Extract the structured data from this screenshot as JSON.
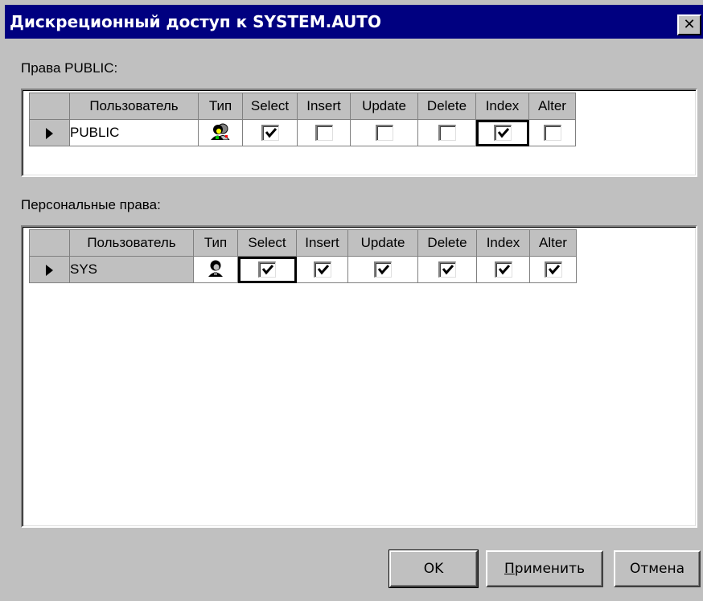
{
  "dialog": {
    "title": "Дискреционный доступ к SYSTEM.AUTO",
    "close_symbol": "✕"
  },
  "public_section": {
    "label": "Права PUBLIC:",
    "columns": [
      "Пользователь",
      "Тип",
      "Select",
      "Insert",
      "Update",
      "Delete",
      "Index",
      "Alter"
    ],
    "rows": [
      {
        "user": "PUBLIC",
        "type_icon": "user-group-icon",
        "select": true,
        "insert": false,
        "update": false,
        "delete": false,
        "index": true,
        "alter": false
      }
    ]
  },
  "personal_section": {
    "label": "Персональные права:",
    "columns": [
      "Пользователь",
      "Тип",
      "Select",
      "Insert",
      "Update",
      "Delete",
      "Index",
      "Alter"
    ],
    "rows": [
      {
        "user": "SYS",
        "type_icon": "user-icon",
        "select": true,
        "insert": true,
        "update": true,
        "delete": true,
        "index": true,
        "alter": true
      }
    ]
  },
  "buttons": {
    "ok": "OK",
    "apply_mnemonic": "П",
    "apply_rest": "рименить",
    "cancel": "Отмена"
  }
}
